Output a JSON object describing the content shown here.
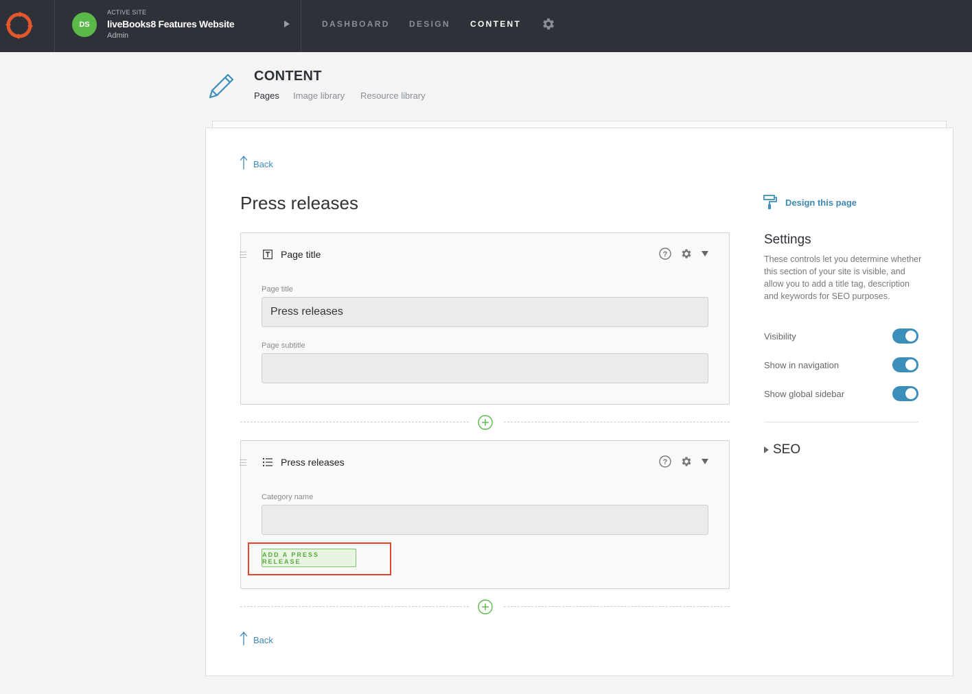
{
  "topbar": {
    "active_site_label": "ACTIVE SITE",
    "site_name": "liveBooks8 Features Website",
    "user_role": "Admin",
    "avatar_initials": "DS",
    "nav": [
      {
        "label": "DASHBOARD",
        "active": false
      },
      {
        "label": "DESIGN",
        "active": false
      },
      {
        "label": "CONTENT",
        "active": true
      }
    ]
  },
  "header": {
    "title": "CONTENT",
    "tabs": [
      {
        "label": "Pages",
        "active": true
      },
      {
        "label": "Image library",
        "active": false
      },
      {
        "label": "Resource library",
        "active": false
      }
    ]
  },
  "main": {
    "back_label": "Back",
    "page_title": "Press releases",
    "sections": [
      {
        "title": "Page title",
        "fields": [
          {
            "label": "Page title",
            "value": "Press releases"
          },
          {
            "label": "Page subtitle",
            "value": ""
          }
        ]
      },
      {
        "title": "Press releases",
        "fields": [
          {
            "label": "Category name",
            "value": ""
          }
        ],
        "button_label": "ADD A PRESS RELEASE"
      }
    ]
  },
  "sidebar": {
    "design_link": "Design this page",
    "settings_title": "Settings",
    "settings_description": "These controls let you determine whether this section of your site is visible, and allow you to add a title tag, description and keywords for SEO purposes.",
    "toggles": [
      {
        "label": "Visibility",
        "on": true
      },
      {
        "label": "Show in navigation",
        "on": true
      },
      {
        "label": "Show global sidebar",
        "on": true
      }
    ],
    "seo_label": "SEO"
  },
  "colors": {
    "topbar_bg": "#2e3238",
    "accent_blue": "#3c8fba",
    "accent_green": "#5bb94a",
    "logo_orange": "#e2582c",
    "highlight_red": "#e2452c"
  }
}
